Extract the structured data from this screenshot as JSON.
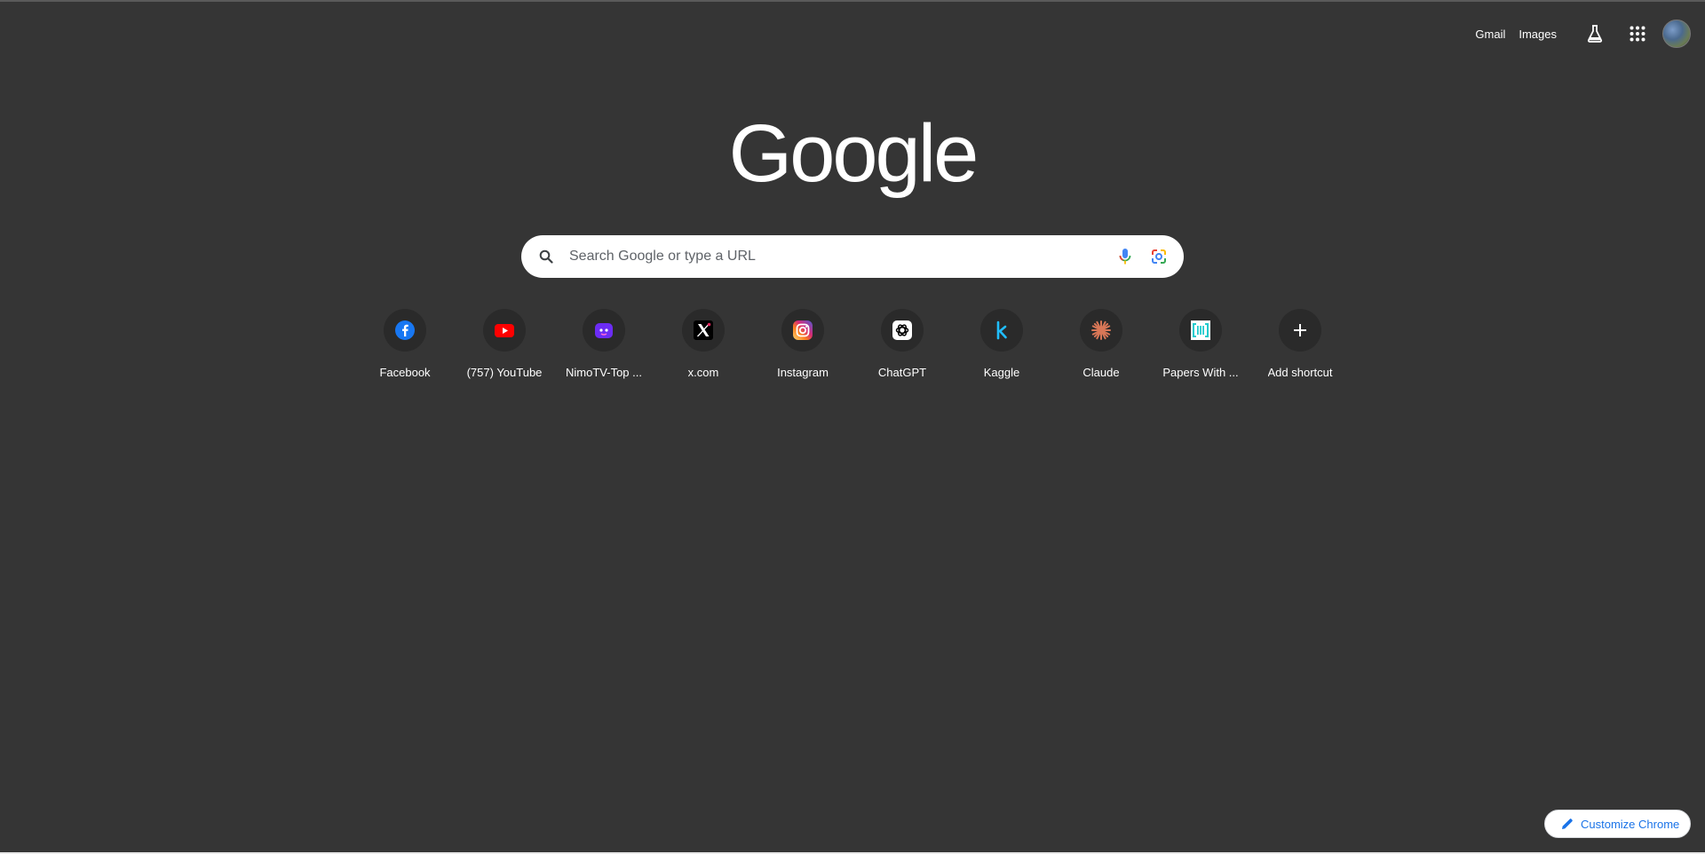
{
  "topbar": {
    "gmail": "Gmail",
    "images": "Images",
    "labs_icon": "flask-icon",
    "apps_icon": "apps-grid-icon",
    "avatar_icon": "profile-avatar"
  },
  "logo": {
    "text": "Google"
  },
  "search": {
    "placeholder": "Search Google or type a URL",
    "search_icon": "search-icon",
    "voice_icon": "microphone-icon",
    "lens_icon": "google-lens-icon"
  },
  "shortcuts": [
    {
      "label": "Facebook",
      "icon": "facebook-icon",
      "color": "#1877f2"
    },
    {
      "label": "(757) YouTube",
      "icon": "youtube-icon",
      "color": "#ff0000"
    },
    {
      "label": "NimoTV-Top ...",
      "icon": "nimotv-icon",
      "color": "#6c2cf5"
    },
    {
      "label": "x.com",
      "icon": "x-icon",
      "color": "#000000"
    },
    {
      "label": "Instagram",
      "icon": "instagram-icon",
      "color": "#e1306c"
    },
    {
      "label": "ChatGPT",
      "icon": "chatgpt-icon",
      "color": "#ffffff"
    },
    {
      "label": "Kaggle",
      "icon": "kaggle-icon",
      "color": "#20beff"
    },
    {
      "label": "Claude",
      "icon": "claude-icon",
      "color": "#d97757"
    },
    {
      "label": "Papers With ...",
      "icon": "paperswithcode-icon",
      "color": "#21cbce"
    },
    {
      "label": "Add shortcut",
      "icon": "plus-icon",
      "color": "#ffffff"
    }
  ],
  "customize": {
    "label": "Customize Chrome",
    "icon": "pencil-icon",
    "color": "#1a73e8"
  }
}
